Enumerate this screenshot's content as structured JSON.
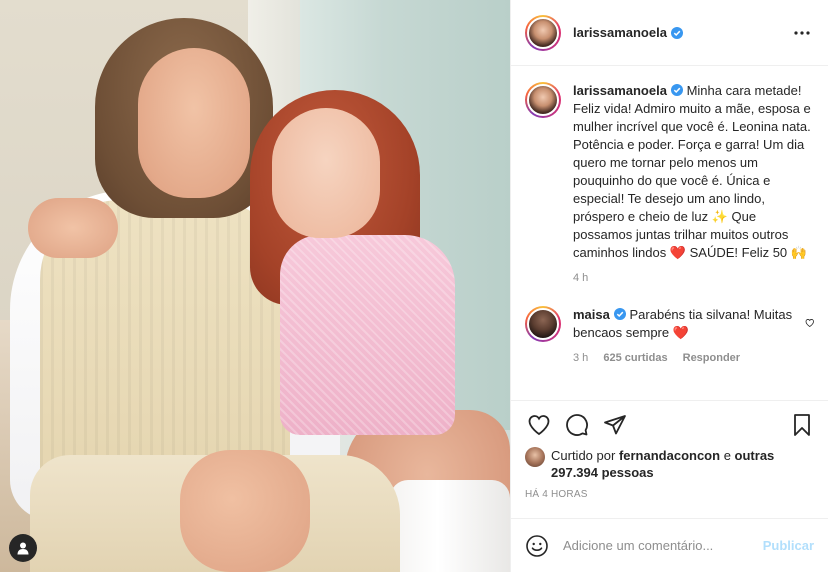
{
  "post": {
    "username": "larissamanoela",
    "verified": true,
    "more_icon": "ellipsis-icon"
  },
  "caption": {
    "username": "larissamanoela",
    "text": "Minha cara metade! Feliz vida! Admiro muito a mãe, esposa e mulher incrível que você é. Leonina nata. Potência e poder. Força e garra! Um dia quero me tornar pelo menos um pouquinho do que você é. Única e especial! Te desejo um ano lindo, próspero e cheio de luz ✨ Que possamos juntas trilhar muitos outros caminhos lindos ❤️ SAÚDE! Feliz 50 🙌",
    "time": "4 h"
  },
  "reply": {
    "username": "maisa",
    "verified": true,
    "text": "Parabéns tia silvana! Muitas bencaos sempre ❤️",
    "time": "3 h",
    "likes": "625 curtidas",
    "reply_label": "Responder"
  },
  "actions": {
    "like_icon": "heart-icon",
    "comment_icon": "comment-icon",
    "share_icon": "share-icon",
    "save_icon": "bookmark-icon"
  },
  "likes": {
    "prefix": "Curtido por",
    "user": "fernandaconcon",
    "middle": "e",
    "others": "outras 297.394 pessoas"
  },
  "timestamp": "HÁ 4 HORAS",
  "add_comment": {
    "placeholder": "Adicione um comentário...",
    "publish_label": "Publicar",
    "emoji_icon": "smile-icon"
  },
  "colors": {
    "verified": "#3897f0",
    "heart_red": "#ed4956",
    "muted": "#8e8e8e",
    "publish_disabled": "#b2dffc"
  }
}
